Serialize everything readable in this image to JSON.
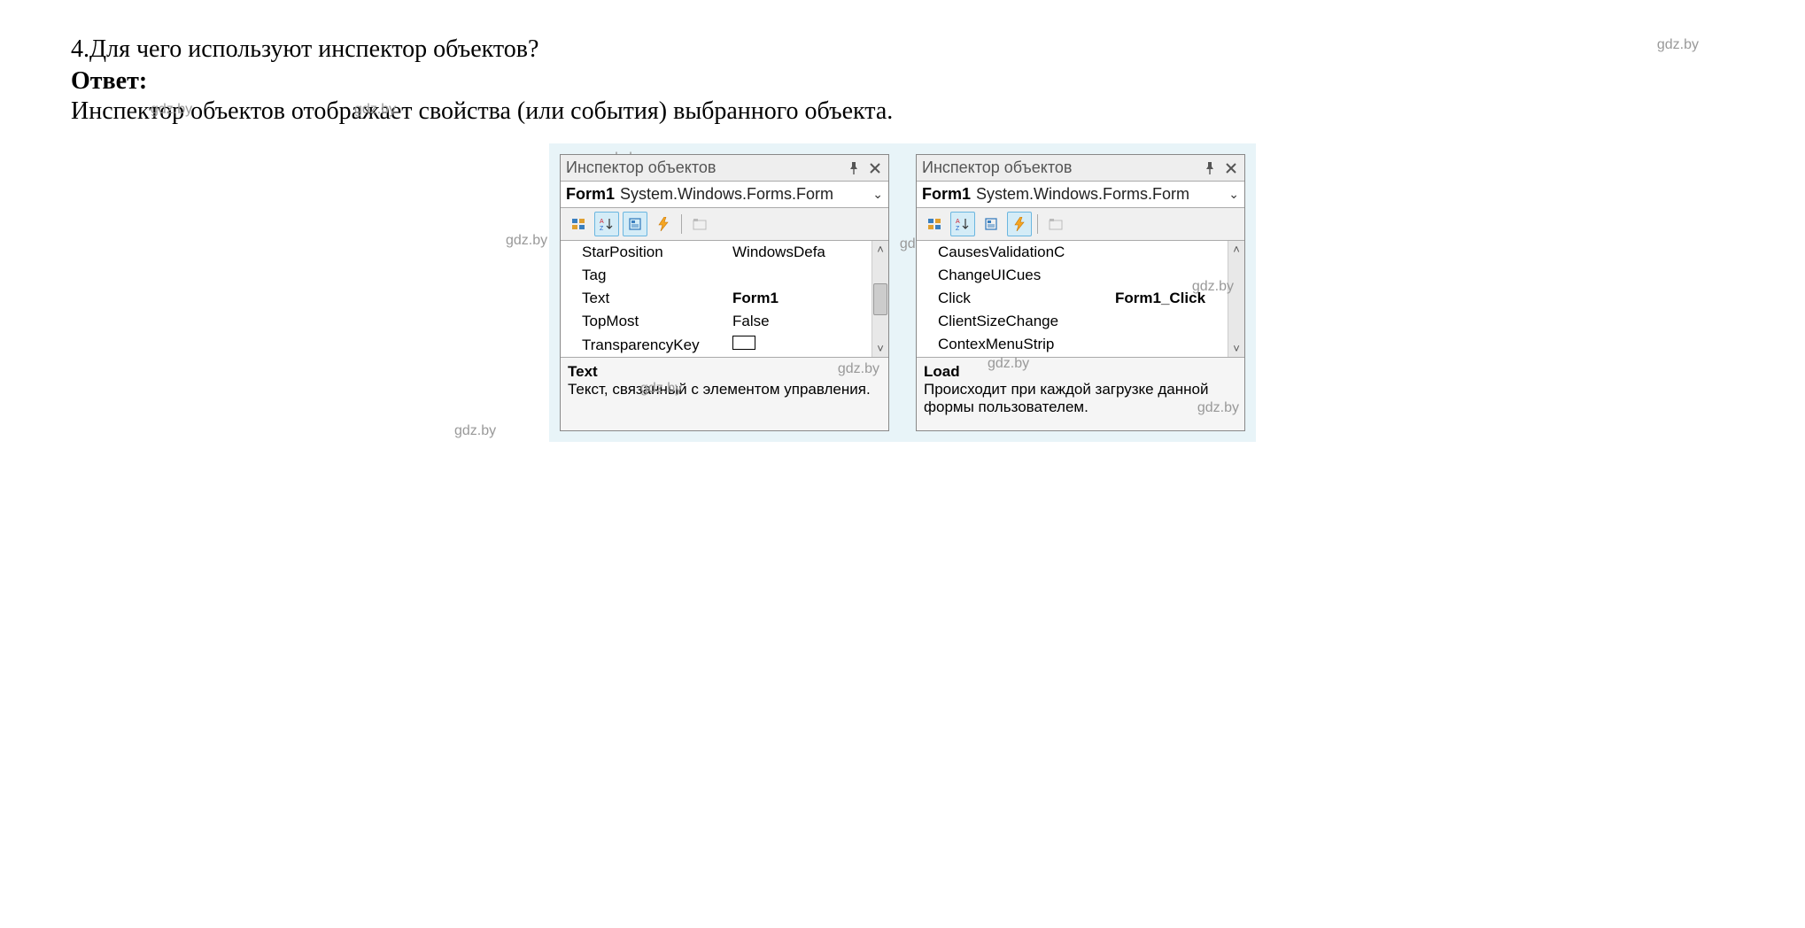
{
  "question": "4.Для чего используют инспектор объектов?",
  "answer_label": "Ответ:",
  "answer_text": "Инспектор объектов отображает свойства (или события) выбранного объекта.",
  "watermark": "gdz.by",
  "panelA": {
    "title": "Инспектор объектов",
    "object_name": "Form1",
    "object_type": "System.Windows.Forms.Form",
    "rows": [
      {
        "name": "StarPosition",
        "value": "WindowsDefa",
        "bold": false
      },
      {
        "name": "Tag",
        "value": "",
        "bold": false
      },
      {
        "name": "Text",
        "value": "Form1",
        "bold": true
      },
      {
        "name": "TopMost",
        "value": "False",
        "bold": false
      },
      {
        "name": "TransparencyKey",
        "value": "[color]",
        "bold": false
      }
    ],
    "desc_title": "Text",
    "desc_text": "Текст, связанный с элементом управления."
  },
  "panelB": {
    "title": "Инспектор объектов",
    "object_name": "Form1",
    "object_type": "System.Windows.Forms.Form",
    "rows": [
      {
        "name": "CausesValidationC",
        "value": "",
        "bold": false
      },
      {
        "name": "ChangeUICues",
        "value": "",
        "bold": false
      },
      {
        "name": "Click",
        "value": "Form1_Click",
        "bold": true
      },
      {
        "name": "ClientSizeChange",
        "value": "",
        "bold": false
      },
      {
        "name": "ContexMenuStrip",
        "value": "",
        "bold": false
      }
    ],
    "desc_title": "Load",
    "desc_text": "Происходит при каждой загрузке данной формы пользователем."
  }
}
